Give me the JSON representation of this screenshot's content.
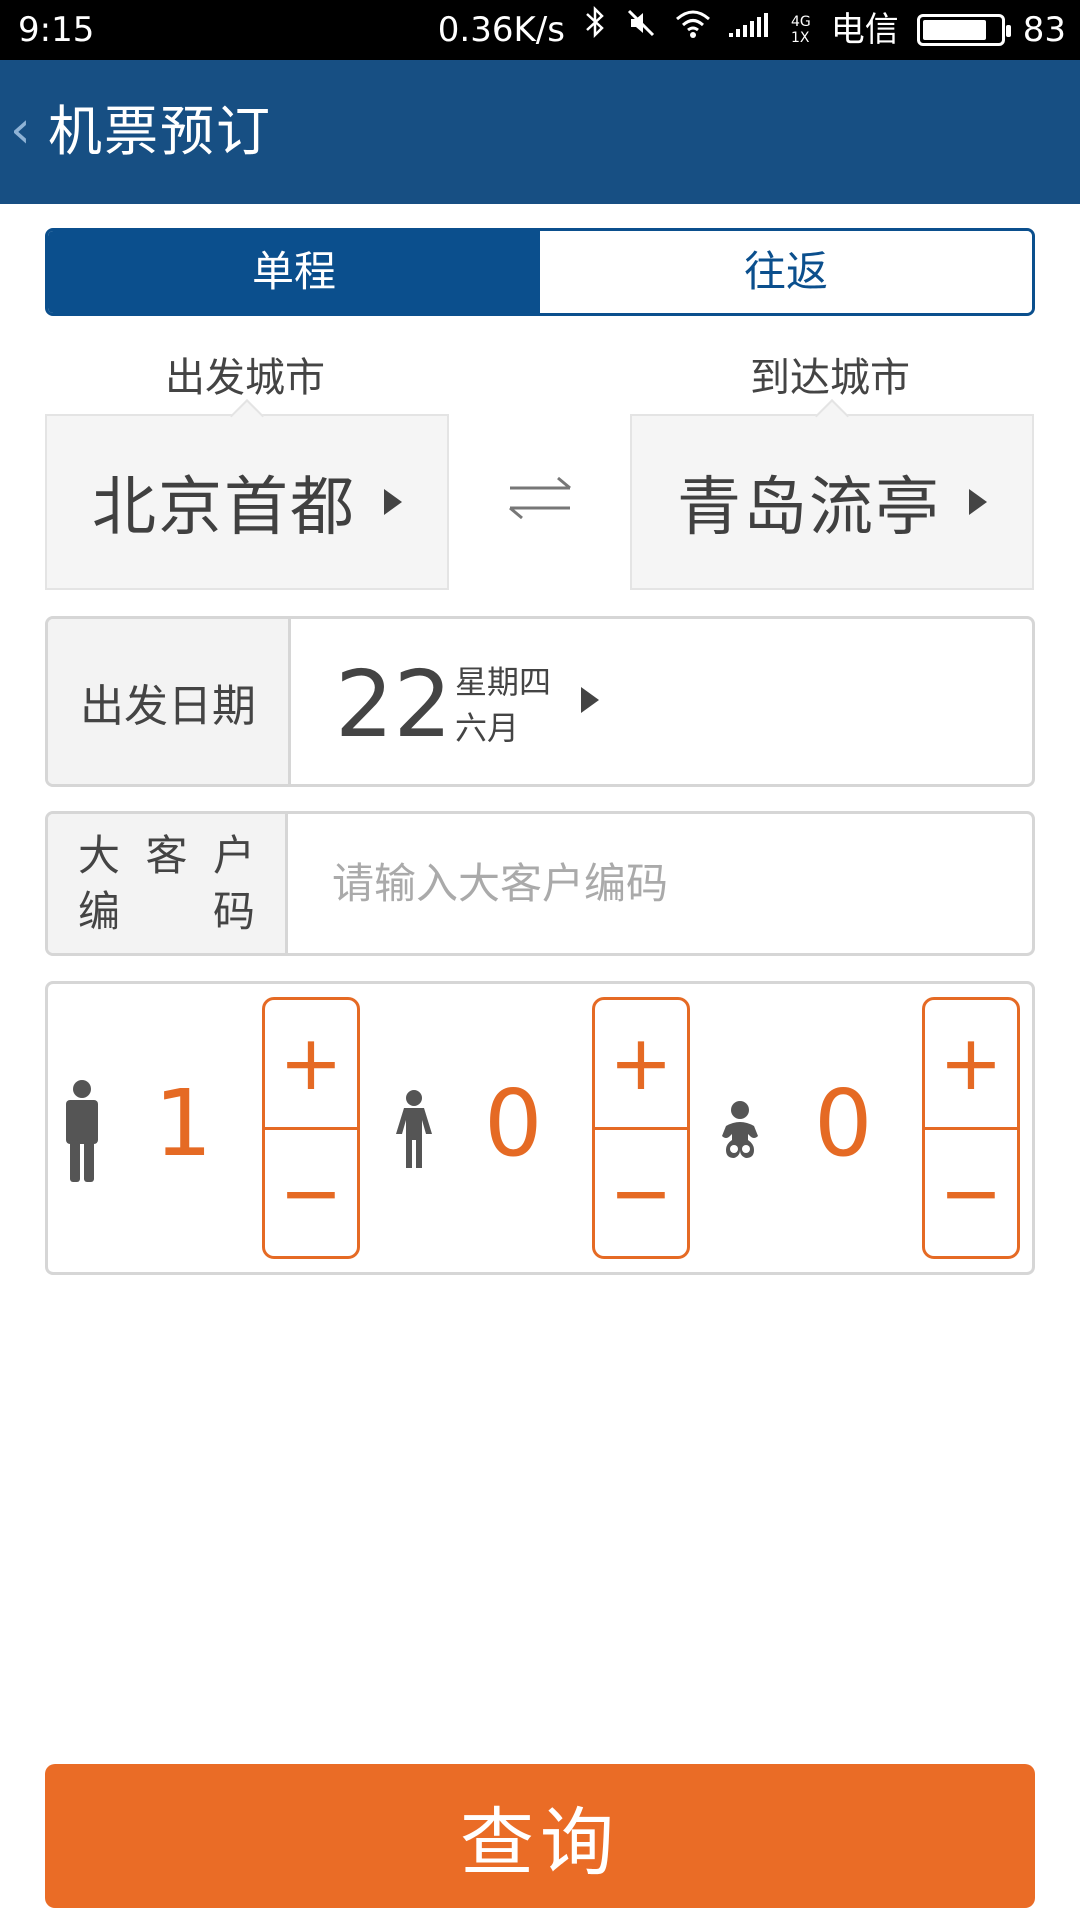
{
  "status_bar": {
    "time": "9:15",
    "speed": "0.36K/s",
    "net_top": "4G",
    "net_bottom": "1X",
    "carrier": "电信",
    "battery": "83",
    "battery_level": 0.83
  },
  "header": {
    "back_icon": "‹",
    "title": "机票预订"
  },
  "trip_tabs": {
    "one_way": "单程",
    "round_trip": "往返",
    "selected": "one_way"
  },
  "route": {
    "departure_label": "出发城市",
    "arrival_label": "到达城市",
    "departure_city": "北京首都",
    "arrival_city": "青岛流亭"
  },
  "date": {
    "label": "出发日期",
    "day": "22",
    "weekday": "星期四",
    "month": "六月"
  },
  "corporate": {
    "label_line1": [
      "大",
      "客",
      "户"
    ],
    "label_line2": [
      "编",
      "码"
    ],
    "placeholder": "请输入大客户编码",
    "value": ""
  },
  "passengers": {
    "adult": {
      "icon": "adult-icon",
      "count": "1"
    },
    "child": {
      "icon": "child-icon",
      "count": "0"
    },
    "infant": {
      "icon": "infant-icon",
      "count": "0"
    },
    "plus": "+",
    "minus": "−"
  },
  "query_button": "查询",
  "colors": {
    "header": "#174f83",
    "tab_active": "#0b4f8d",
    "accent": "#e56a24",
    "query": "#ea6c26"
  }
}
